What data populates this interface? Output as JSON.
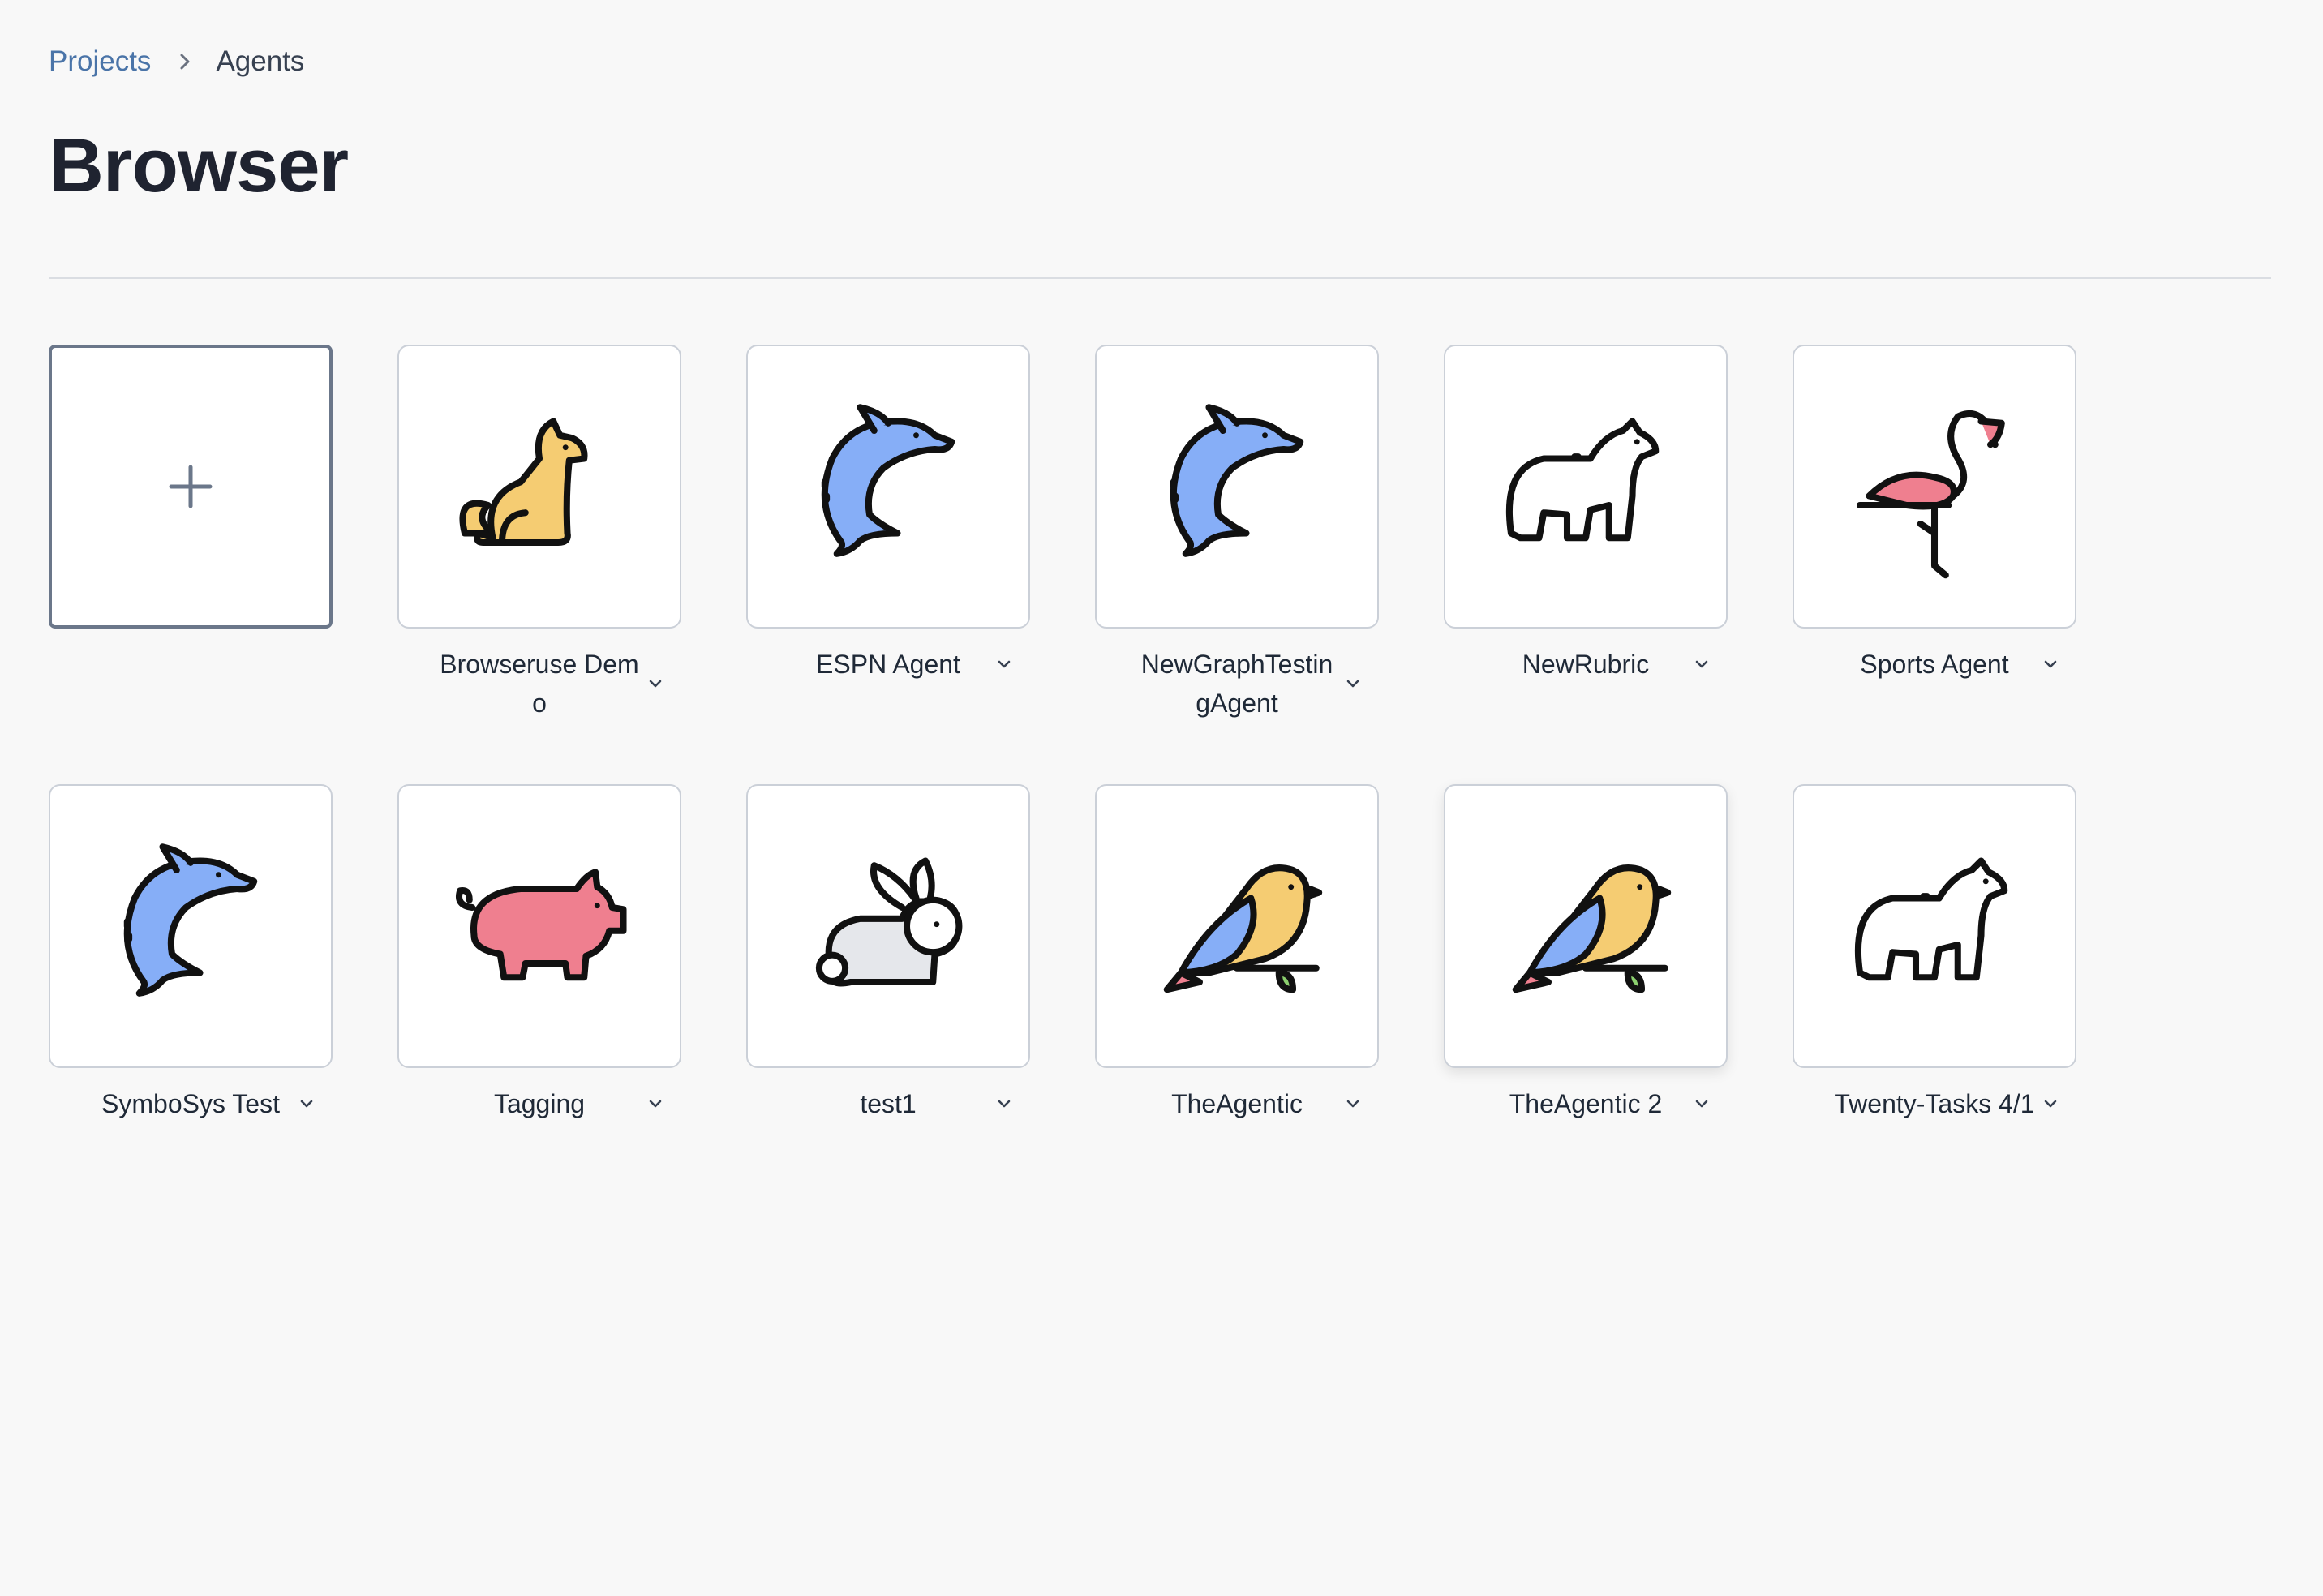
{
  "breadcrumb": {
    "parent": "Projects",
    "current": "Agents"
  },
  "page": {
    "title": "Browser"
  },
  "new_card": {
    "icon": "plus-icon"
  },
  "agents": [
    {
      "name": "Browseruse Demo",
      "icon": "dog-icon",
      "color": "#f5cc72"
    },
    {
      "name": "ESPN Agent",
      "icon": "dolphin-icon",
      "color": "#86aef7"
    },
    {
      "name": "NewGraphTestingAgent",
      "icon": "dolphin-icon",
      "color": "#86aef7"
    },
    {
      "name": "NewRubric",
      "icon": "polar-bear-icon",
      "color": "#ffffff"
    },
    {
      "name": "Sports Agent",
      "icon": "flamingo-icon",
      "color": "#ef7f8f"
    },
    {
      "name": "SymboSys Test",
      "icon": "dolphin-icon",
      "color": "#86aef7"
    },
    {
      "name": "Tagging",
      "icon": "pig-icon",
      "color": "#ef7f8f"
    },
    {
      "name": "test1",
      "icon": "rabbit-icon",
      "color": "#e5e7eb"
    },
    {
      "name": "TheAgentic",
      "icon": "bird-icon",
      "color": "#f5cc72"
    },
    {
      "name": "TheAgentic 2",
      "icon": "bird-icon",
      "color": "#f5cc72"
    },
    {
      "name": "Twenty-Tasks 4/1",
      "icon": "polar-bear-icon",
      "color": "#ffffff"
    }
  ]
}
